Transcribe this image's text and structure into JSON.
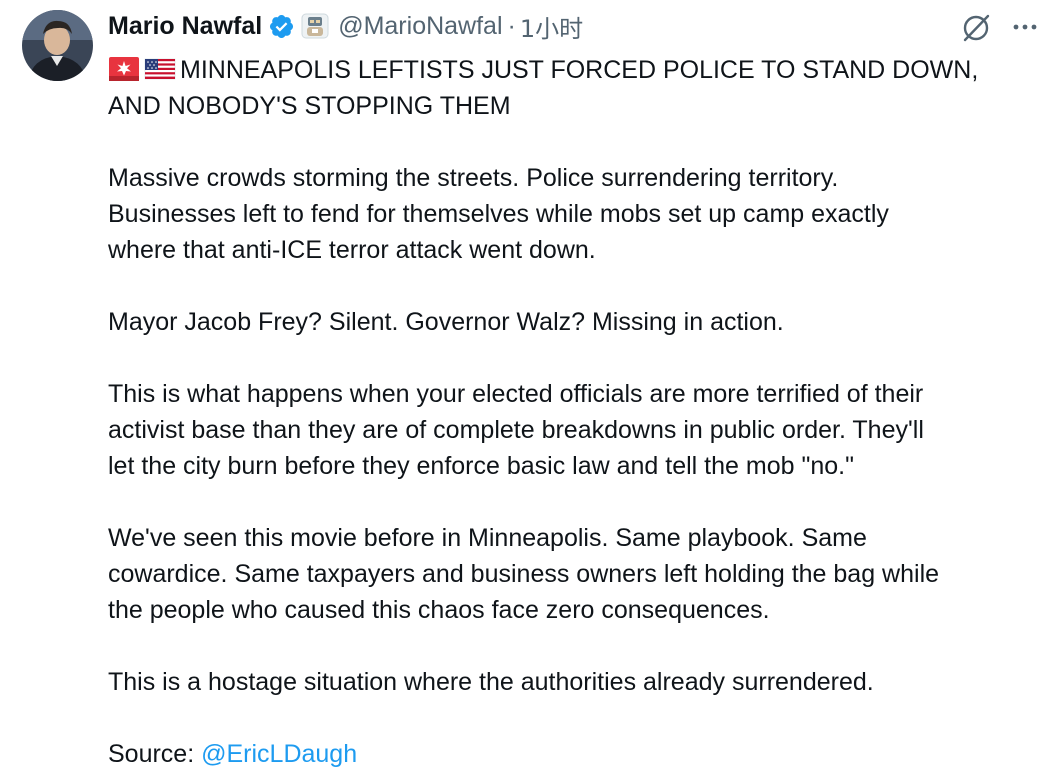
{
  "author": {
    "display_name": "Mario Nawfal",
    "handle": "@MarioNawfal",
    "separator": "·",
    "time": "1小时"
  },
  "colors": {
    "text": "#0f1419",
    "secondary": "#536471",
    "accent": "#1d9bf0",
    "background": "#ffffff"
  },
  "icons": {
    "verified": "verified-badge-icon",
    "affiliate": "affiliate-badge-icon",
    "grok": "grok-icon",
    "more": "more-icon",
    "siren": "siren-emoji",
    "flag": "us-flag-emoji"
  },
  "tweet": {
    "headline_line1": "MINNEAPOLIS LEFTISTS JUST FORCED POLICE TO STAND DOWN,",
    "headline_line2": "AND NOBODY'S STOPPING THEM",
    "p1_l1": "Massive crowds storming the streets. Police surrendering territory.",
    "p1_l2": "Businesses left to fend for themselves while mobs set up camp exactly",
    "p1_l3": "where that anti-ICE terror attack went down.",
    "p2_l1": "Mayor Jacob Frey? Silent. Governor Walz? Missing in action.",
    "p3_l1": "This is what happens when your elected officials are more terrified of their",
    "p3_l2": "activist base than they are of complete breakdowns in public order. They'll",
    "p3_l3": "let the city burn before they enforce basic law and tell the mob \"no.\"",
    "p4_l1": "We've seen this movie before in Minneapolis. Same playbook. Same",
    "p4_l2": "cowardice. Same taxpayers and business owners left holding the bag while",
    "p4_l3": "the people who caused this chaos face zero consequences.",
    "p5_l1": "This is a hostage situation where the authorities already surrendered.",
    "source_label": "Source: ",
    "source_mention": "@EricLDaugh"
  }
}
